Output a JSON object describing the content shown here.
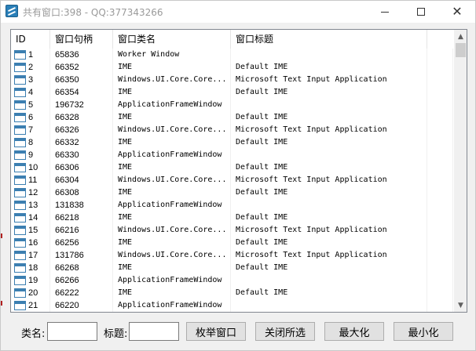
{
  "window": {
    "title": "共有窗口:398 - QQ:377343266",
    "min_icon": "minimize-icon",
    "max_icon": "maximize-icon",
    "close_icon": "close-icon"
  },
  "table": {
    "columns": [
      "ID",
      "窗口句柄",
      "窗口类名",
      "窗口标题"
    ],
    "rows": [
      {
        "id": "1",
        "handle": "65836",
        "class": "Worker Window",
        "title": ""
      },
      {
        "id": "2",
        "handle": "66352",
        "class": "IME",
        "title": "Default IME"
      },
      {
        "id": "3",
        "handle": "66350",
        "class": "Windows.UI.Core.Core...",
        "title": "Microsoft Text Input Application"
      },
      {
        "id": "4",
        "handle": "66354",
        "class": "IME",
        "title": "Default IME"
      },
      {
        "id": "5",
        "handle": "196732",
        "class": "ApplicationFrameWindow",
        "title": ""
      },
      {
        "id": "6",
        "handle": "66328",
        "class": "IME",
        "title": "Default IME"
      },
      {
        "id": "7",
        "handle": "66326",
        "class": "Windows.UI.Core.Core...",
        "title": "Microsoft Text Input Application"
      },
      {
        "id": "8",
        "handle": "66332",
        "class": "IME",
        "title": "Default IME"
      },
      {
        "id": "9",
        "handle": "66330",
        "class": "ApplicationFrameWindow",
        "title": ""
      },
      {
        "id": "10",
        "handle": "66306",
        "class": "IME",
        "title": "Default IME"
      },
      {
        "id": "11",
        "handle": "66304",
        "class": "Windows.UI.Core.Core...",
        "title": "Microsoft Text Input Application"
      },
      {
        "id": "12",
        "handle": "66308",
        "class": "IME",
        "title": "Default IME"
      },
      {
        "id": "13",
        "handle": "131838",
        "class": "ApplicationFrameWindow",
        "title": ""
      },
      {
        "id": "14",
        "handle": "66218",
        "class": "IME",
        "title": "Default IME"
      },
      {
        "id": "15",
        "handle": "66216",
        "class": "Windows.UI.Core.Core...",
        "title": "Microsoft Text Input Application"
      },
      {
        "id": "16",
        "handle": "66256",
        "class": "IME",
        "title": "Default IME"
      },
      {
        "id": "17",
        "handle": "131786",
        "class": "Windows.UI.Core.Core...",
        "title": "Microsoft Text Input Application"
      },
      {
        "id": "18",
        "handle": "66268",
        "class": "IME",
        "title": "Default IME"
      },
      {
        "id": "19",
        "handle": "66266",
        "class": "ApplicationFrameWindow",
        "title": ""
      },
      {
        "id": "20",
        "handle": "66222",
        "class": "IME",
        "title": "Default IME"
      },
      {
        "id": "21",
        "handle": "66220",
        "class": "ApplicationFrameWindow",
        "title": ""
      }
    ],
    "row_icon": "window-icon"
  },
  "scrollbar": {
    "up_icon": "scroll-up-arrow-icon",
    "down_icon": "scroll-down-arrow-icon",
    "up_glyph": "▲",
    "down_glyph": "▼"
  },
  "controls": {
    "class_label": "类名:",
    "class_value": "",
    "title_label": "标题:",
    "title_value": "",
    "enum_button": "枚举窗口",
    "close_selected_button": "关闭所选",
    "maximize_button": "最大化",
    "minimize_button": "最小化"
  },
  "colors": {
    "row_icon_blue": "#3c7fb1",
    "edge_mark_red": "#b02020"
  }
}
